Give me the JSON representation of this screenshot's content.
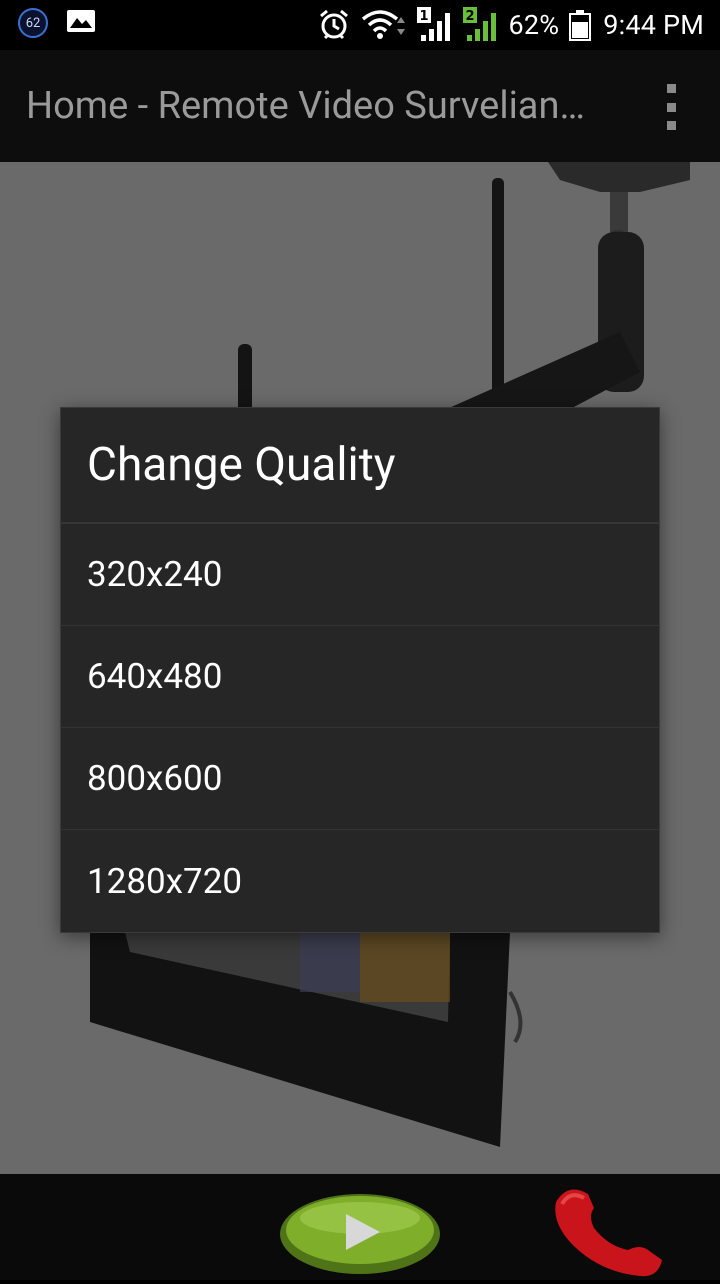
{
  "status_bar": {
    "notification_count": "62",
    "sim1_label": "1",
    "sim2_label": "2",
    "battery_percent": "62%",
    "time": "9:44 PM",
    "icons": [
      "gallery-icon",
      "alarm-icon",
      "wifi-icon",
      "signal-sim1-icon",
      "signal-sim2-icon",
      "battery-icon"
    ]
  },
  "app_bar": {
    "title": "Home - Remote Video Survelian…",
    "overflow_icon": "more-vert-icon"
  },
  "dialog": {
    "title": "Change Quality",
    "options": [
      "320x240",
      "640x480",
      "800x600",
      "1280x720"
    ]
  },
  "bottom_bar": {
    "play_icon": "play-icon",
    "hangup_icon": "phone-hangup-icon"
  },
  "colors": {
    "status_bg": "#000000",
    "app_bar_bg": "#0d0d0d",
    "dialog_bg": "#262626",
    "signal_green": "#6abf3a",
    "notif_ring": "#3d6fd1",
    "play_green": "#7fae2a",
    "hangup_red": "#c8141a"
  }
}
